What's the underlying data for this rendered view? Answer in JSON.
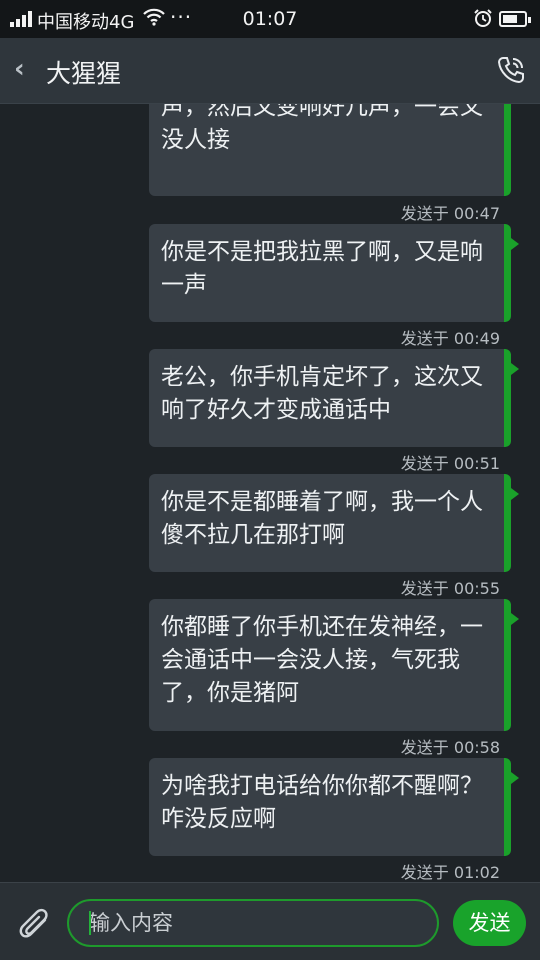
{
  "status_bar": {
    "carrier": "中国移动4G",
    "more": "···",
    "time": "01:07"
  },
  "header": {
    "contact_name": "大猩猩",
    "back_glyph": "‹"
  },
  "messages": [
    {
      "text": "老公，你手机有问题，一会响一声，然后又变响好几声，一会又没人接",
      "top": 0,
      "time": "发送于 00:47"
    },
    {
      "text": "你是不是把我拉黑了啊，又是响一声",
      "time": "发送于 00:49"
    },
    {
      "text": "老公，你手机肯定坏了，这次又响了好久才变成通话中",
      "time": "发送于 00:51"
    },
    {
      "text": "你是不是都睡着了啊，我一个人傻不拉几在那打啊",
      "time": "发送于 00:55"
    },
    {
      "text": "你都睡了你手机还在发神经，一会通话中一会没人接，气死我了，你是猪阿",
      "time": "发送于 00:58"
    },
    {
      "text": "为啥我打电话给你你都不醒啊？咋没反应啊",
      "time": "发送于 01:02"
    }
  ],
  "input": {
    "placeholder": "输入内容",
    "send_label": "发送"
  },
  "colors": {
    "accent": "#1aa12a",
    "bubble": "#383f46",
    "background": "#1e2327",
    "header": "#2f363c"
  }
}
